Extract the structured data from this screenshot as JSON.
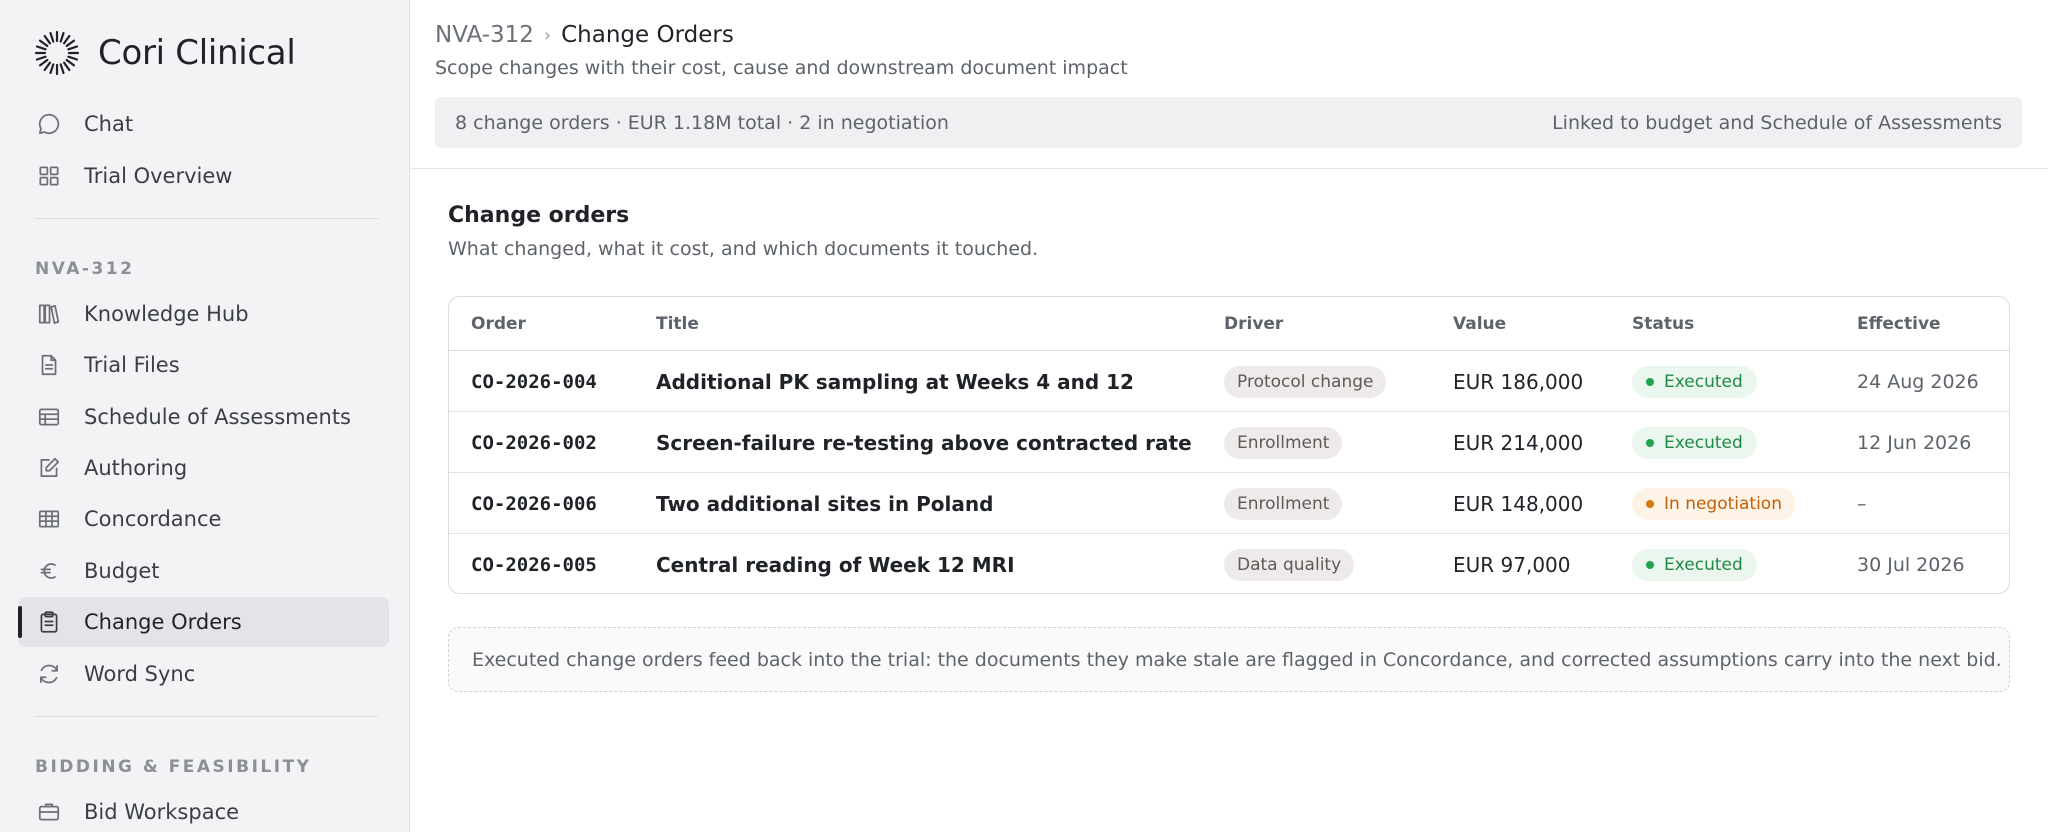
{
  "app": {
    "name": "Cori Clinical"
  },
  "sidebar": {
    "top_items": [
      {
        "label": "Chat",
        "icon": "chat-icon"
      },
      {
        "label": "Trial Overview",
        "icon": "grid-icon"
      }
    ],
    "trial_section": {
      "label": "NVA-312"
    },
    "trial_items": [
      {
        "label": "Knowledge Hub",
        "icon": "books-icon"
      },
      {
        "label": "Trial Files",
        "icon": "file-icon"
      },
      {
        "label": "Schedule of Assessments",
        "icon": "schedule-icon"
      },
      {
        "label": "Authoring",
        "icon": "edit-icon"
      },
      {
        "label": "Concordance",
        "icon": "table-icon"
      },
      {
        "label": "Budget",
        "icon": "euro-icon"
      },
      {
        "label": "Change Orders",
        "icon": "clipboard-icon",
        "active": true
      },
      {
        "label": "Word Sync",
        "icon": "sync-icon"
      }
    ],
    "bidding_section": {
      "label": "BIDDING & FEASIBILITY"
    },
    "bidding_items": [
      {
        "label": "Bid Workspace",
        "icon": "briefcase-icon"
      }
    ]
  },
  "header": {
    "breadcrumb_parent": "NVA-312",
    "breadcrumb_sep": "›",
    "breadcrumb_current": "Change Orders",
    "subtitle": "Scope changes with their cost, cause and downstream document impact",
    "summary_left": "8 change orders · EUR 1.18M total · 2 in negotiation",
    "summary_right": "Linked to budget and Schedule of Assessments"
  },
  "section": {
    "title": "Change orders",
    "subtitle": "What changed, what it cost, and which documents it touched."
  },
  "table": {
    "columns": [
      "Order",
      "Title",
      "Driver",
      "Value",
      "Status",
      "Effective"
    ],
    "rows": [
      {
        "order": "CO-2026-004",
        "title": "Additional PK sampling at Weeks 4 and 12",
        "driver": "Protocol change",
        "value": "EUR 186,000",
        "status": "Executed",
        "status_kind": "ok",
        "effective": "24 Aug 2026"
      },
      {
        "order": "CO-2026-002",
        "title": "Screen-failure re-testing above contracted rate",
        "driver": "Enrollment",
        "value": "EUR 214,000",
        "status": "Executed",
        "status_kind": "ok",
        "effective": "12 Jun 2026"
      },
      {
        "order": "CO-2026-006",
        "title": "Two additional sites in Poland",
        "driver": "Enrollment",
        "value": "EUR 148,000",
        "status": "In negotiation",
        "status_kind": "neg",
        "effective": "–"
      },
      {
        "order": "CO-2026-005",
        "title": "Central reading of Week 12 MRI",
        "driver": "Data quality",
        "value": "EUR 97,000",
        "status": "Executed",
        "status_kind": "ok",
        "effective": "30 Jul 2026"
      }
    ]
  },
  "note": "Executed change orders feed back into the trial: the documents they make stale are flagged in Concordance, and corrected assumptions carry into the next bid.",
  "colors": {
    "executed": "#1f8a44",
    "negotiation": "#c25e06",
    "sidebar_bg": "#f3f3f5"
  }
}
